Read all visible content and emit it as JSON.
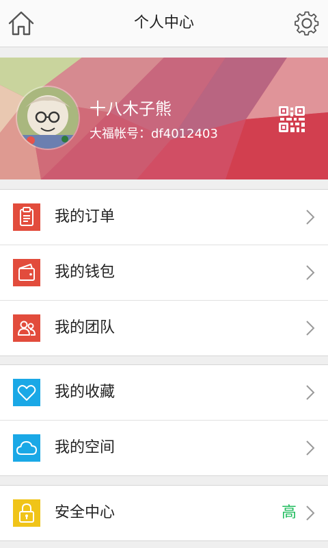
{
  "header": {
    "title": "个人中心",
    "home_icon": "home-icon",
    "settings_icon": "gear-icon"
  },
  "profile": {
    "nickname": "十八木子熊",
    "account": "大福帐号：df4012403",
    "qr_icon": "qr-code-icon"
  },
  "menu_groups": [
    {
      "items": [
        {
          "label": "我的订单",
          "icon": "clipboard-icon",
          "color": "#e24c3c"
        },
        {
          "label": "我的钱包",
          "icon": "wallet-icon",
          "color": "#e24c3c"
        },
        {
          "label": "我的团队",
          "icon": "team-icon",
          "color": "#e24c3c"
        }
      ]
    },
    {
      "items": [
        {
          "label": "我的收藏",
          "icon": "heart-icon",
          "color": "#1aa8e6"
        },
        {
          "label": "我的空间",
          "icon": "cloud-icon",
          "color": "#1aa8e6"
        }
      ]
    },
    {
      "items": [
        {
          "label": "安全中心",
          "icon": "lock-icon",
          "color": "#f0c419",
          "value": "高",
          "value_color": "#1fbb5c"
        }
      ]
    }
  ]
}
